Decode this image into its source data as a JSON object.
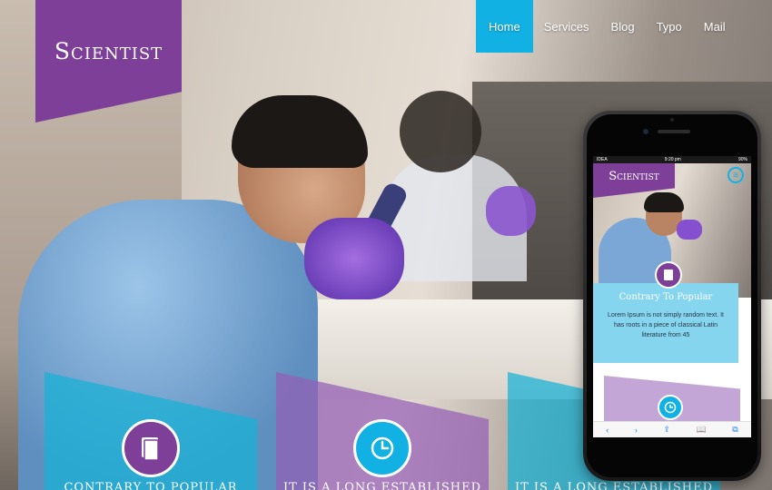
{
  "site": {
    "logo": "Scientist"
  },
  "nav": {
    "items": [
      {
        "label": "Home",
        "active": true
      },
      {
        "label": "Services"
      },
      {
        "label": "Blog"
      },
      {
        "label": "Typo"
      },
      {
        "label": "Mail"
      }
    ]
  },
  "features": [
    {
      "title": "Contrary to popular",
      "icon": "book-icon",
      "color": "#16b2d6"
    },
    {
      "title": "It is a long established",
      "icon": "clock-icon",
      "color": "#945eb6"
    },
    {
      "title": "It is a long established",
      "icon": "",
      "color": "#16b2d6"
    }
  ],
  "phone": {
    "status": {
      "carrier": "IDEA",
      "time": "9:20 pm",
      "battery": "90%"
    },
    "logo": "Scientist",
    "card": {
      "title": "Contrary to popular",
      "text": "Lorem Ipsum is not simply random text. It has roots in a piece of classical Latin literature from 45"
    },
    "toolbar": [
      "‹",
      "›",
      "⇪",
      "📖",
      "⧉"
    ]
  },
  "colors": {
    "accent_purple": "#7d3f98",
    "accent_blue": "#12b1e4"
  }
}
